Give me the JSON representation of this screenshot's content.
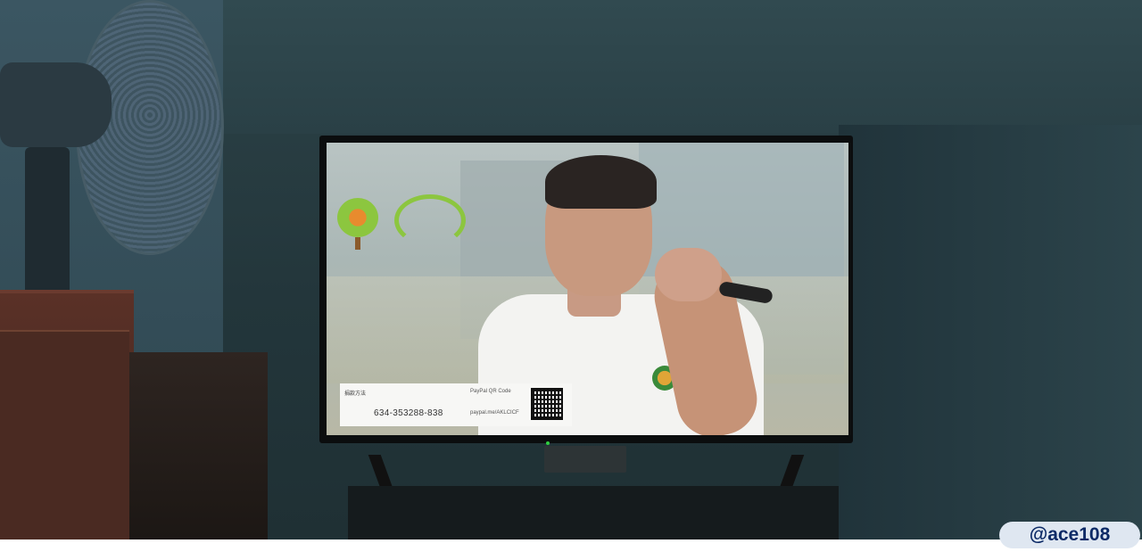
{
  "scene": {
    "watermark": "@ace108"
  },
  "tv_broadcast": {
    "logo_left_text": "",
    "logo_right_text": "",
    "donation_banner": {
      "label": "捐款方法",
      "description": "",
      "phone": "634-353288-838",
      "paypal_title": "PayPal QR Code",
      "paypal_url": "paypal.me/AKLCICF"
    }
  }
}
